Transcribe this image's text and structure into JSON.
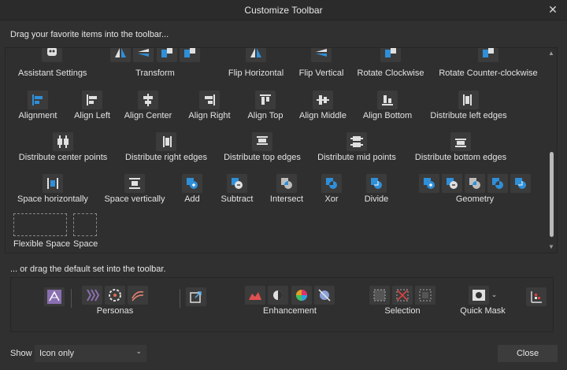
{
  "window": {
    "title": "Customize Toolbar",
    "close_glyph": "✕"
  },
  "top_heading": "Drag your favorite items into the toolbar...",
  "items": {
    "assistant_settings": "Assistant Settings",
    "transform": "Transform",
    "flip_horizontal": "Flip Horizontal",
    "flip_vertical": "Flip Vertical",
    "rotate_clockwise": "Rotate Clockwise",
    "rotate_counter_clockwise": "Rotate Counter-clockwise",
    "alignment": "Alignment",
    "align_left": "Align Left",
    "align_center": "Align Center",
    "align_right": "Align Right",
    "align_top": "Align Top",
    "align_middle": "Align Middle",
    "align_bottom": "Align Bottom",
    "distribute_left_edges": "Distribute left edges",
    "distribute_center_points": "Distribute center points",
    "distribute_right_edges": "Distribute right edges",
    "distribute_top_edges": "Distribute top edges",
    "distribute_mid_points": "Distribute mid points",
    "distribute_bottom_edges": "Distribute bottom edges",
    "space_horizontally": "Space horizontally",
    "space_vertically": "Space vertically",
    "add": "Add",
    "subtract": "Subtract",
    "intersect": "Intersect",
    "xor": "Xor",
    "divide": "Divide",
    "geometry": "Geometry",
    "flexible_space": "Flexible Space",
    "space": "Space"
  },
  "bottom_heading": "... or drag the default set into the toolbar.",
  "default_set": {
    "personas": "Personas",
    "enhancement": "Enhancement",
    "selection": "Selection",
    "quick_mask": "Quick Mask"
  },
  "footer": {
    "show_label": "Show",
    "show_value": "Icon only",
    "close_label": "Close"
  },
  "colors": {
    "accent": "#2f8fd8",
    "background": "#303030",
    "panel": "#2f2f2f",
    "persona_purple": "#8a6fb0"
  }
}
